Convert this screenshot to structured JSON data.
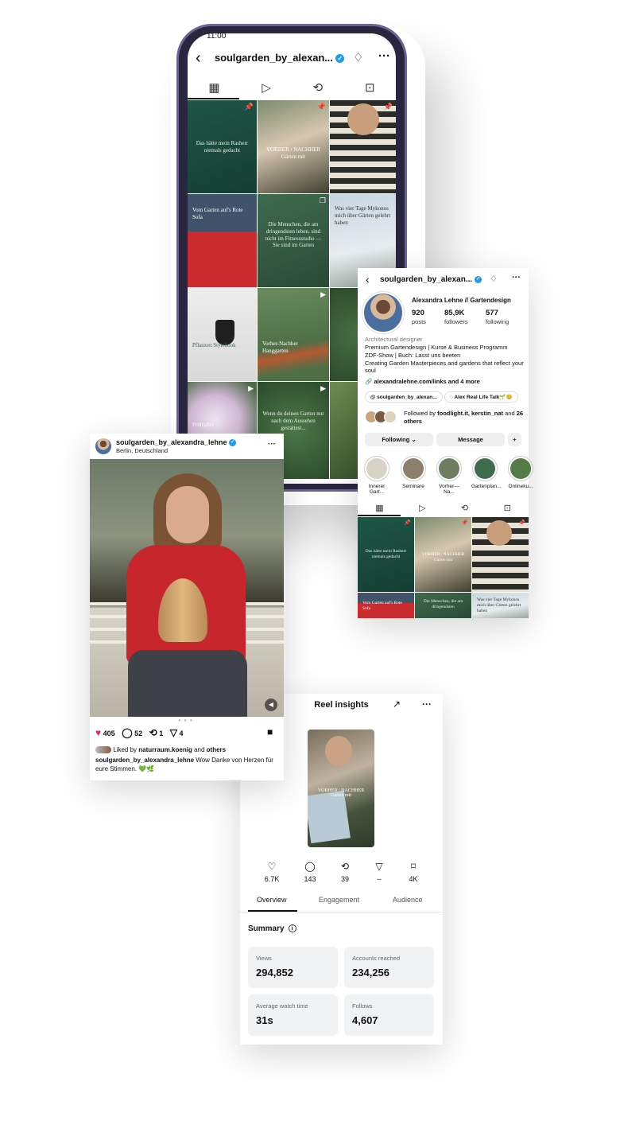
{
  "phone": {
    "status_time": "11:00",
    "username": "soulgarden_by_alexan...",
    "verified_mark": "✓",
    "icons": {
      "back": "chevron-left-icon",
      "bell": "bell-icon",
      "more": "more-icon"
    },
    "tabs": [
      "grid-icon",
      "reels-icon",
      "reposts-icon",
      "tagged-icon"
    ],
    "tiles": {
      "t1": "Das hätte mein Rasherr niemals gedacht",
      "t2": "VORHER / NACHHER Gärten mit",
      "t4": "Vom Garten auf's Rote Sofa",
      "t5": "Die Menschen, die am dringendsten leben, sind nicht im Fitnessstudio — Sie sind im Garten",
      "t6": "Was vier Tage Mykonos mich über Gärten gelehrt haben",
      "t7": "Pflanzen Stylebook",
      "t8": "Vorher-Nachher Hanggarten",
      "t10": "Frühjahrs",
      "t11": "Wenn du deinen Garten nur nach dem Aussehen gestaltest..."
    }
  },
  "profile": {
    "username": "soulgarden_by_alexan...",
    "name": "Alexandra Lehne // Gartendesign",
    "stats": [
      {
        "value": "920",
        "label": "posts"
      },
      {
        "value": "85,9K",
        "label": "followers"
      },
      {
        "value": "577",
        "label": "following"
      }
    ],
    "category": "Architectural designer",
    "bio": [
      "Premium Gartendesign | Kurse & Business Programm",
      "ZDF-Show | Buch: Lasst uns beeten",
      "Creating Garden Masterpieces and gardens that reflect your soul"
    ],
    "link": "alexandralehne.com/links and 4 more",
    "chips": [
      "soulgarden_by_alexan...",
      "Alex Real Life Talk🌱😊"
    ],
    "followed_prefix": "Followed by ",
    "followed_names": "foodlight.it, kerstin_nat",
    "followed_mid": " and ",
    "followed_others": "26 others",
    "buttons": {
      "following": "Following ⌄",
      "message": "Message",
      "add": "+"
    },
    "highlights": [
      "Innerer Gart...",
      "Seminare",
      "Vorher—Na...",
      "Gartenplan...",
      "Onlineku..."
    ],
    "tiles": {
      "t1": "Das hätte mein Rasherr niemals gedacht",
      "t2": "VORHER / NACHHER Gärten mit",
      "t4": "Vom Garten auf's Rote Sofa",
      "t5": "Die Menschen, die am dringendsten",
      "t6": "Was vier Tage Mykonos mich über Gärten gelehrt haben"
    }
  },
  "post": {
    "username": "soulgarden_by_alexandra_lehne",
    "location": "Berlin, Deutschland",
    "likes": "405",
    "comments": "52",
    "reposts": "1",
    "shares": "4",
    "liked_by_prefix": "Liked by ",
    "liked_by_user": "naturraum.koenig",
    "liked_by_mid": " and ",
    "liked_by_others": "others",
    "caption_user": "soulgarden_by_alexandra_lehne",
    "caption_text": " Wow Danke von Herzen für eure Stimmen. 💚🌿"
  },
  "insights": {
    "title": "Reel insights",
    "metrics": [
      {
        "icon": "heart-icon",
        "value": "6.7K"
      },
      {
        "icon": "comment-icon",
        "value": "143"
      },
      {
        "icon": "repost-icon",
        "value": "39"
      },
      {
        "icon": "share-icon",
        "value": "--"
      },
      {
        "icon": "save-icon",
        "value": "4K"
      }
    ],
    "tabs": [
      "Overview",
      "Engagement",
      "Audience"
    ],
    "summary_label": "Summary",
    "boxes": [
      {
        "label": "Views",
        "value": "294,852"
      },
      {
        "label": "Accounts reached",
        "value": "234,256"
      },
      {
        "label": "Average watch time",
        "value": "31s"
      },
      {
        "label": "Follows",
        "value": "4,607"
      }
    ],
    "thumb_text": "VORHER / NACHHER Gärten mit"
  }
}
